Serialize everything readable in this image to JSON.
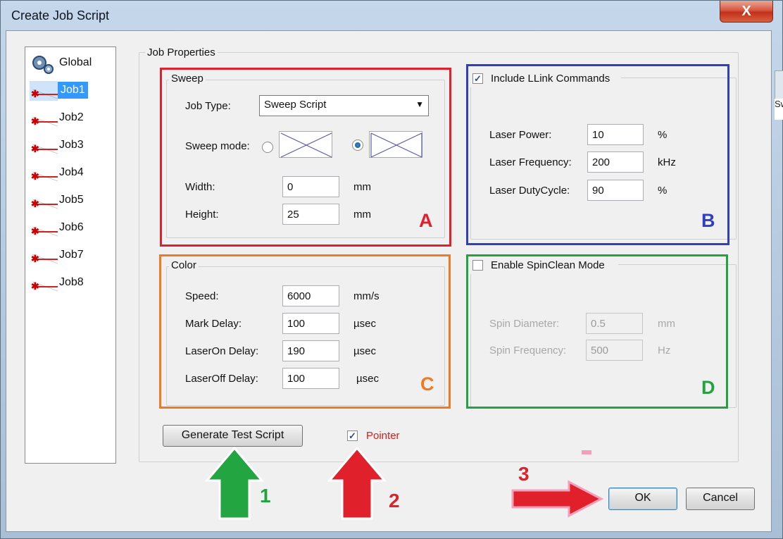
{
  "window": {
    "title": "Create Job Script",
    "close_glyph": "X"
  },
  "side_strip_text": "Swee",
  "tree": {
    "items": [
      {
        "label": "Global",
        "icon": "gears-icon"
      },
      {
        "label": "Job1",
        "icon": "job-icon",
        "selected": true
      },
      {
        "label": "Job2",
        "icon": "job-icon"
      },
      {
        "label": "Job3",
        "icon": "job-icon"
      },
      {
        "label": "Job4",
        "icon": "job-icon"
      },
      {
        "label": "Job5",
        "icon": "job-icon"
      },
      {
        "label": "Job6",
        "icon": "job-icon"
      },
      {
        "label": "Job7",
        "icon": "job-icon"
      },
      {
        "label": "Job8",
        "icon": "job-icon"
      }
    ]
  },
  "job_properties": {
    "title": "Job Properties"
  },
  "sweep": {
    "title": "Sweep",
    "job_type_label": "Job Type:",
    "job_type_value": "Sweep Script",
    "sweep_mode_label": "Sweep mode:",
    "sweep_mode_selected": 2,
    "width_label": "Width:",
    "width_value": "0",
    "width_unit": "mm",
    "height_label": "Height:",
    "height_value": "25",
    "height_unit": "mm"
  },
  "llink": {
    "checkbox_label": "Include LLink Commands",
    "checked": true,
    "power_label": "Laser Power:",
    "power_value": "10",
    "power_unit": "%",
    "freq_label": "Laser Frequency:",
    "freq_value": "200",
    "freq_unit": "kHz",
    "duty_label": "Laser DutyCycle:",
    "duty_value": "90",
    "duty_unit": "%"
  },
  "color": {
    "title": "Color",
    "speed_label": "Speed:",
    "speed_value": "6000",
    "speed_unit": "mm/s",
    "mark_label": "Mark Delay:",
    "mark_value": "100",
    "mark_unit": "µsec",
    "on_label": "LaserOn Delay:",
    "on_value": "190",
    "on_unit": "µsec",
    "off_label": "LaserOff Delay:",
    "off_value": "100",
    "off_unit": "µsec"
  },
  "spinclean": {
    "checkbox_label": "Enable SpinClean Mode",
    "checked": false,
    "diameter_label": "Spin Diameter:",
    "diameter_value": "0.5",
    "diameter_unit": "mm",
    "freq_label": "Spin Frequency:",
    "freq_value": "500",
    "freq_unit": "Hz"
  },
  "buttons": {
    "generate": "Generate Test Script",
    "pointer_label": "Pointer",
    "pointer_checked": true,
    "ok": "OK",
    "cancel": "Cancel"
  },
  "annotations": {
    "labels": {
      "a": "A",
      "b": "B",
      "c": "C",
      "d": "D"
    },
    "numbers": {
      "n1": "1",
      "n2": "2",
      "n3": "3"
    },
    "colors": {
      "red": "#e0202a",
      "blue": "#2f3fbf",
      "orange": "#f07a22",
      "green": "#21a33f",
      "pink": "#f4a0b8"
    }
  }
}
